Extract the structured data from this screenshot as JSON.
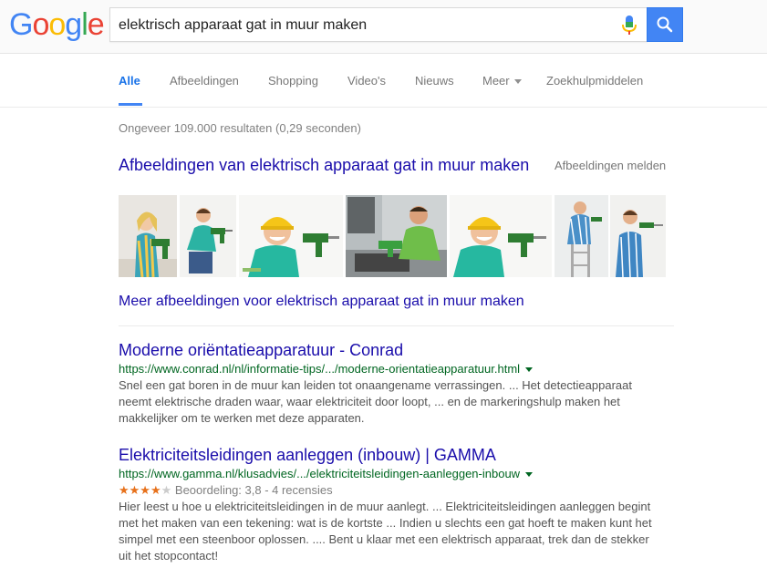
{
  "header": {
    "logo_text": "Google",
    "search_query": "elektrisch apparaat gat in muur maken",
    "logo_colors": [
      "#4285f4",
      "#ea4335",
      "#fbbc05",
      "#4285f4",
      "#34a853",
      "#ea4335"
    ],
    "search_button_color": "#4285f4"
  },
  "tabs": [
    {
      "label": "Alle",
      "active": true
    },
    {
      "label": "Afbeeldingen"
    },
    {
      "label": "Shopping"
    },
    {
      "label": "Video's"
    },
    {
      "label": "Nieuws"
    },
    {
      "label": "Meer"
    },
    {
      "label": "Zoekhulpmiddelen"
    }
  ],
  "stats": "Ongeveer 109.000 resultaten (0,29 seconden)",
  "images": {
    "heading": "Afbeeldingen van elektrisch apparaat gat in muur maken",
    "report": "Afbeeldingen melden",
    "more": "Meer afbeeldingen voor elektrisch apparaat gat in muur maken"
  },
  "results": [
    {
      "title": "Moderne oriëntatieapparatuur - Conrad",
      "url": "https://www.conrad.nl/nl/informatie-tips/.../moderne-orientatieapparatuur.html",
      "snippet_lines": [
        "Snel een gat boren in de muur kan leiden tot onaangename verrassingen. ... Het detectieapparaat",
        "neemt elektrische draden waar, waar elektriciteit door loopt, ... en de markeringshulp maken het",
        "makkelijker om te werken met deze apparaten."
      ]
    },
    {
      "title": "Elektriciteitsleidingen aanleggen (inbouw) | GAMMA",
      "url": "https://www.gamma.nl/klusadvies/.../elektriciteitsleidingen-aanleggen-inbouw",
      "rating_text": "Beoordeling: 3,8 - 4 recensies",
      "rating_value": 3.8,
      "snippet_lines": [
        "Hier leest u hoe u elektriciteitsleidingen in de muur aanlegt. ... Elektriciteitsleidingen aanleggen begint",
        "met het maken van een tekening: wat is de kortste ... Indien u slechts een gat hoeft te maken kunt het",
        "simpel met een steenboor oplossen. .... Bent u klaar met een elektrisch apparaat, trek dan de stekker",
        "uit het stopcontact!"
      ]
    }
  ]
}
